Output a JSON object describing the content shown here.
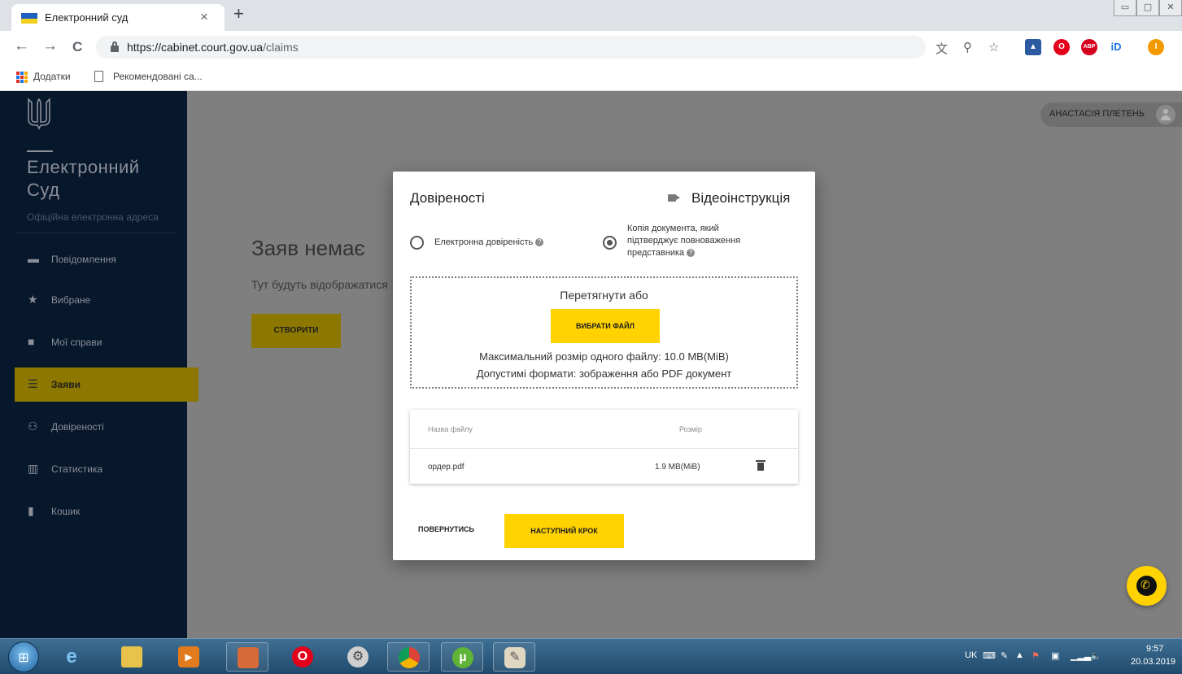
{
  "browser": {
    "tab_title": "Електронний суд",
    "tab_close": "×",
    "new_tab": "+",
    "url_host": "https://cabinet.court.gov.ua",
    "url_path": "/claims",
    "back": "←",
    "forward": "→",
    "reload": "C",
    "bookmarks": [
      "Додатки",
      "Рекомендовані са..."
    ]
  },
  "app": {
    "brand_title": "Електронний Суд",
    "brand_subtitle": "Офіційна електронна адреса",
    "user_name": "АНАСТАСІЯ ПЛЕТЕНЬ",
    "menu": [
      {
        "label": "Повідомлення",
        "icon": "message-icon",
        "active": false
      },
      {
        "label": "Вибране",
        "icon": "star-icon",
        "active": false
      },
      {
        "label": "Мої справи",
        "icon": "folder-icon",
        "active": false
      },
      {
        "label": "Заяви",
        "icon": "list-icon",
        "active": true
      },
      {
        "label": "Довіреності",
        "icon": "people-icon",
        "active": false
      },
      {
        "label": "Статистика",
        "icon": "chart-icon",
        "active": false
      },
      {
        "label": "Кошик",
        "icon": "trash-icon",
        "active": false
      }
    ],
    "content": {
      "title": "Заяв немає",
      "text": "Тут будуть відображатися",
      "create_label": "СТВОРИТИ"
    }
  },
  "modal": {
    "title": "Довіреності",
    "video_label": "Відеоінструкція",
    "options": [
      {
        "label": "Електронна довіреність",
        "checked": false
      },
      {
        "label": "Копія документа, який підтверджує повноваження представника",
        "checked": true
      }
    ],
    "dropzone": {
      "hint": "Перетягнути або",
      "pick_label": "ВИБРАТИ ФАЙЛ",
      "max_size": "Максимальний розмір одного файлу: 10.0 MB(MiB)",
      "formats": "Допустимі формати: зображення або PDF документ"
    },
    "files": {
      "col_name": "Назва файлу",
      "col_size": "Розмір",
      "rows": [
        {
          "name": "ордер.pdf",
          "size": "1.9 MB(MiB)"
        }
      ]
    },
    "back_label": "ПОВЕРНУТИСЬ",
    "next_label": "НАСТУПНИЙ КРОК"
  },
  "taskbar": {
    "lang": "UK",
    "time": "9:57",
    "date": "20.03.2019"
  },
  "colors": {
    "accent": "#ffd200",
    "sidebar": "#07172c",
    "overlay": "#7f7f7f"
  }
}
